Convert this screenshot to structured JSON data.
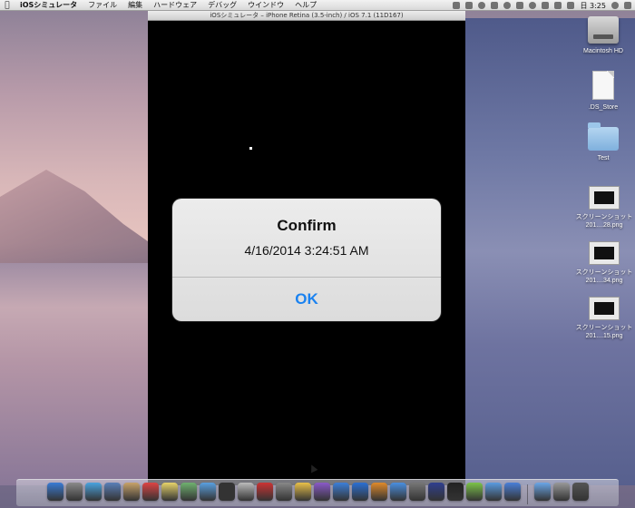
{
  "menubar": {
    "apple_icon": "apple-icon",
    "items": [
      "iOSシミュレータ",
      "ファイル",
      "編集",
      "ハードウェア",
      "デバッグ",
      "ウインドウ",
      "ヘルプ"
    ],
    "clock": "日 3:25"
  },
  "simulator": {
    "window_title": "iOSシミュレータ – iPhone Retina (3.5-inch) / iOS 7.1 (11D167)"
  },
  "alert": {
    "title": "Confirm",
    "message": "4/16/2014 3:24:51 AM",
    "ok_label": "OK"
  },
  "desktop": {
    "items": [
      {
        "label": "Macintosh HD",
        "icon": "hard-drive-icon"
      },
      {
        "label": ".DS_Store",
        "icon": "document-icon"
      },
      {
        "label": "Test",
        "icon": "folder-icon"
      },
      {
        "label": "スクリーンショット 201....28.png",
        "icon": "screenshot-icon"
      },
      {
        "label": "スクリーンショット 201....34.png",
        "icon": "screenshot-icon"
      },
      {
        "label": "スクリーンショット 201....15.png",
        "icon": "screenshot-icon"
      }
    ]
  },
  "dock": {
    "colors": [
      "#3a7bd5",
      "#8a8a8a",
      "#4aa3df",
      "#5a7fb8",
      "#c8a36a",
      "#d44",
      "#e7d36a",
      "#6fb16f",
      "#5aa0e0",
      "#333",
      "#bbb",
      "#c33",
      "#888",
      "#e9c04a",
      "#8a5ac8",
      "#3d7fd8",
      "#2b6fd3",
      "#e08a2a",
      "#4a8fe0",
      "#777",
      "#2f3f8f",
      "#222",
      "#7cc34a",
      "#5a9be0",
      "#4a7fd8",
      "#6aa6e8",
      "#999",
      "#555"
    ]
  },
  "colors": {
    "alert_button": "#1a82f0",
    "simulator_screen": "#000000"
  }
}
